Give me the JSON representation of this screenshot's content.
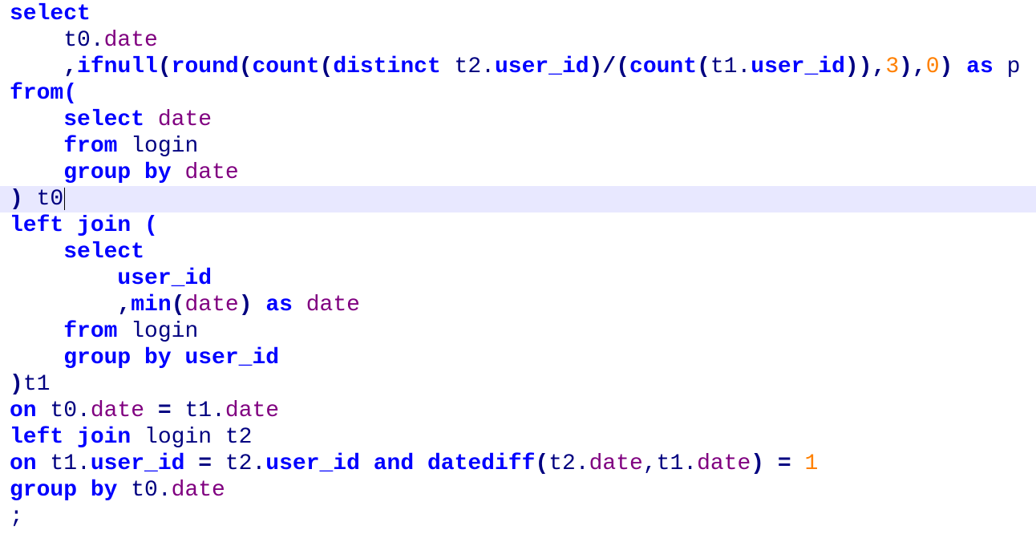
{
  "editor": {
    "colors": {
      "keyword": "#0000ff",
      "column": "#800080",
      "number": "#ff8000",
      "current_line": "#e8e8ff"
    },
    "lines": [
      [
        {
          "t": "kw",
          "v": "select"
        }
      ],
      [
        {
          "t": "pl",
          "v": "    t0."
        },
        {
          "t": "col",
          "v": "date"
        }
      ],
      [
        {
          "t": "pl",
          "v": "    "
        },
        {
          "t": "op",
          "v": ","
        },
        {
          "t": "fn",
          "v": "ifnull"
        },
        {
          "t": "op",
          "v": "("
        },
        {
          "t": "fn",
          "v": "round"
        },
        {
          "t": "op",
          "v": "("
        },
        {
          "t": "fn",
          "v": "count"
        },
        {
          "t": "op",
          "v": "("
        },
        {
          "t": "kw",
          "v": "distinct"
        },
        {
          "t": "pl",
          "v": " t2."
        },
        {
          "t": "kw",
          "v": "user_id"
        },
        {
          "t": "op",
          "v": ")/("
        },
        {
          "t": "fn",
          "v": "count"
        },
        {
          "t": "op",
          "v": "("
        },
        {
          "t": "pl",
          "v": "t1."
        },
        {
          "t": "kw",
          "v": "user_id"
        },
        {
          "t": "op",
          "v": ")),"
        },
        {
          "t": "num",
          "v": "3"
        },
        {
          "t": "op",
          "v": "),"
        },
        {
          "t": "num",
          "v": "0"
        },
        {
          "t": "op",
          "v": ")"
        },
        {
          "t": "pl",
          "v": " "
        },
        {
          "t": "kw",
          "v": "as"
        },
        {
          "t": "pl",
          "v": " p"
        }
      ],
      [
        {
          "t": "kw",
          "v": "from("
        }
      ],
      [
        {
          "t": "pl",
          "v": "    "
        },
        {
          "t": "kw",
          "v": "select"
        },
        {
          "t": "pl",
          "v": " "
        },
        {
          "t": "col",
          "v": "date"
        }
      ],
      [
        {
          "t": "pl",
          "v": "    "
        },
        {
          "t": "kw",
          "v": "from"
        },
        {
          "t": "pl",
          "v": " login"
        }
      ],
      [
        {
          "t": "pl",
          "v": "    "
        },
        {
          "t": "kw",
          "v": "group by"
        },
        {
          "t": "pl",
          "v": " "
        },
        {
          "t": "col",
          "v": "date"
        }
      ],
      [
        {
          "t": "op",
          "v": ")"
        },
        {
          "t": "pl",
          "v": " t0"
        }
      ],
      [
        {
          "t": "kw",
          "v": "left join ("
        }
      ],
      [
        {
          "t": "pl",
          "v": "    "
        },
        {
          "t": "kw",
          "v": "select"
        }
      ],
      [
        {
          "t": "pl",
          "v": "        "
        },
        {
          "t": "kw",
          "v": "user_id"
        }
      ],
      [
        {
          "t": "pl",
          "v": "        "
        },
        {
          "t": "op",
          "v": ","
        },
        {
          "t": "fn",
          "v": "min"
        },
        {
          "t": "op",
          "v": "("
        },
        {
          "t": "col",
          "v": "date"
        },
        {
          "t": "op",
          "v": ")"
        },
        {
          "t": "pl",
          "v": " "
        },
        {
          "t": "kw",
          "v": "as"
        },
        {
          "t": "pl",
          "v": " "
        },
        {
          "t": "col",
          "v": "date"
        }
      ],
      [
        {
          "t": "pl",
          "v": "    "
        },
        {
          "t": "kw",
          "v": "from"
        },
        {
          "t": "pl",
          "v": " login"
        }
      ],
      [
        {
          "t": "pl",
          "v": "    "
        },
        {
          "t": "kw",
          "v": "group by user_id"
        }
      ],
      [
        {
          "t": "op",
          "v": ")"
        },
        {
          "t": "pl",
          "v": "t1"
        }
      ],
      [
        {
          "t": "kw",
          "v": "on"
        },
        {
          "t": "pl",
          "v": " t0."
        },
        {
          "t": "col",
          "v": "date"
        },
        {
          "t": "pl",
          "v": " "
        },
        {
          "t": "op",
          "v": "="
        },
        {
          "t": "pl",
          "v": " t1."
        },
        {
          "t": "col",
          "v": "date"
        }
      ],
      [
        {
          "t": "kw",
          "v": "left join"
        },
        {
          "t": "pl",
          "v": " login t2"
        }
      ],
      [
        {
          "t": "kw",
          "v": "on"
        },
        {
          "t": "pl",
          "v": " t1."
        },
        {
          "t": "kw",
          "v": "user_id"
        },
        {
          "t": "pl",
          "v": " "
        },
        {
          "t": "op",
          "v": "="
        },
        {
          "t": "pl",
          "v": " t2."
        },
        {
          "t": "kw",
          "v": "user_id"
        },
        {
          "t": "pl",
          "v": " "
        },
        {
          "t": "kw",
          "v": "and"
        },
        {
          "t": "pl",
          "v": " "
        },
        {
          "t": "fn",
          "v": "datediff"
        },
        {
          "t": "op",
          "v": "("
        },
        {
          "t": "pl",
          "v": "t2."
        },
        {
          "t": "col",
          "v": "date"
        },
        {
          "t": "pl",
          "v": ",t1."
        },
        {
          "t": "col",
          "v": "date"
        },
        {
          "t": "op",
          "v": ")"
        },
        {
          "t": "pl",
          "v": " "
        },
        {
          "t": "op",
          "v": "="
        },
        {
          "t": "pl",
          "v": " "
        },
        {
          "t": "num",
          "v": "1"
        }
      ],
      [
        {
          "t": "kw",
          "v": "group by"
        },
        {
          "t": "pl",
          "v": " t0."
        },
        {
          "t": "col",
          "v": "date"
        }
      ],
      [
        {
          "t": "pl",
          "v": ";"
        }
      ]
    ],
    "current_line_index": 7
  }
}
